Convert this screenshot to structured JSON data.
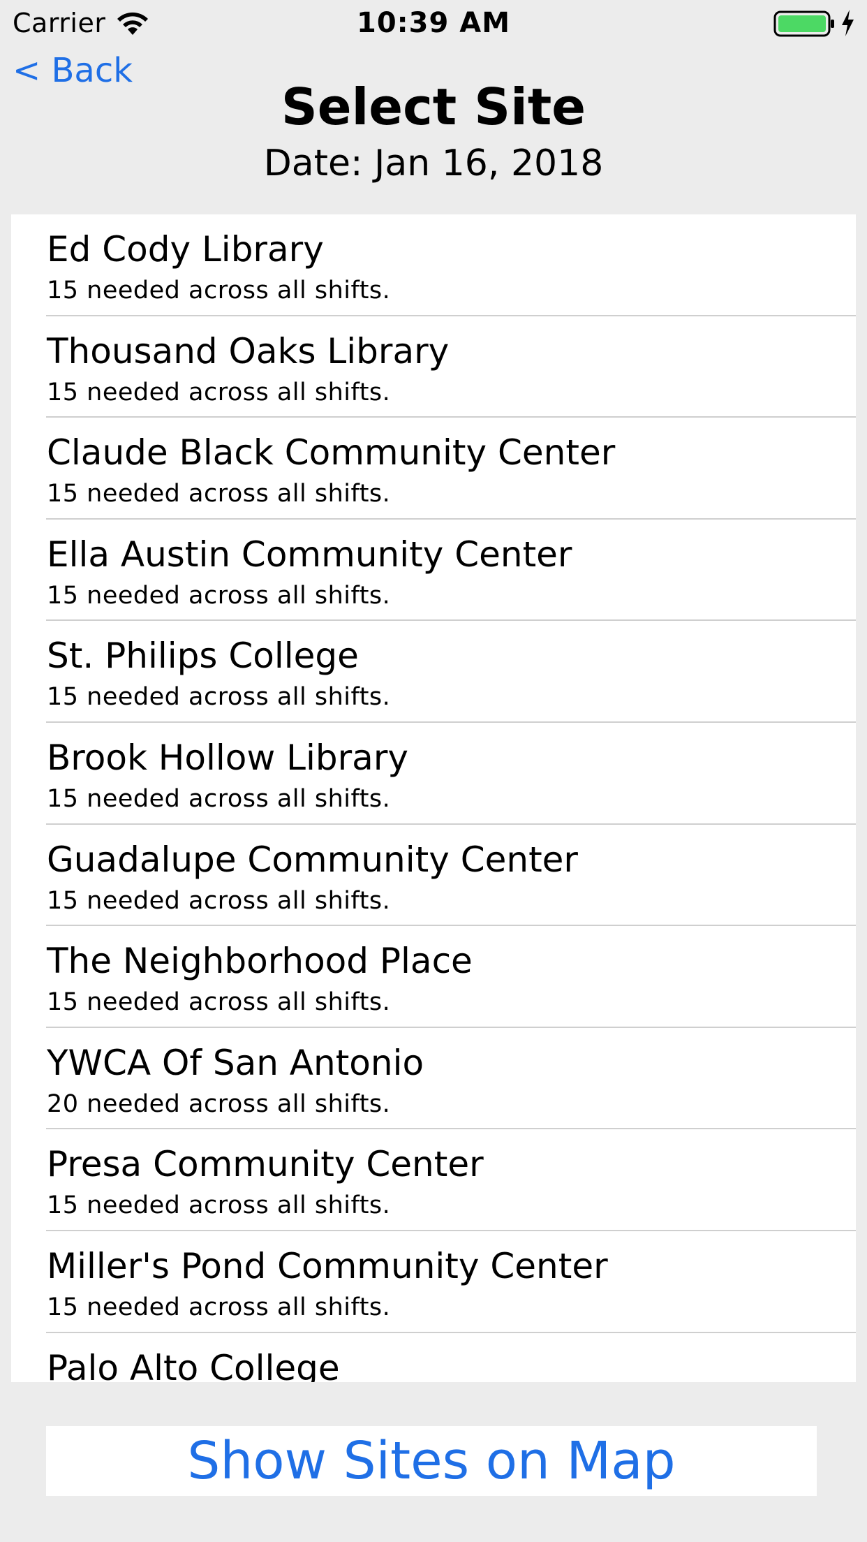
{
  "status_bar": {
    "carrier": "Carrier",
    "time": "10:39 AM",
    "wifi_icon": "wifi-icon",
    "battery_icon": "battery-icon",
    "charging_icon": "bolt-icon",
    "battery_color": "#4cd964"
  },
  "nav": {
    "back_label": "< Back",
    "title": "Select Site",
    "subtitle": "Date: Jan 16, 2018"
  },
  "sites": [
    {
      "name": "Ed Cody Library",
      "detail": "15 needed across all shifts."
    },
    {
      "name": "Thousand Oaks Library",
      "detail": "15 needed across all shifts."
    },
    {
      "name": "Claude Black Community Center",
      "detail": "15 needed across all shifts."
    },
    {
      "name": "Ella Austin Community Center",
      "detail": "15 needed across all shifts."
    },
    {
      "name": "St. Philips College",
      "detail": "15 needed across all shifts."
    },
    {
      "name": "Brook Hollow Library",
      "detail": "15 needed across all shifts."
    },
    {
      "name": "Guadalupe Community Center",
      "detail": "15 needed across all shifts."
    },
    {
      "name": "The Neighborhood Place",
      "detail": "15 needed across all shifts."
    },
    {
      "name": "YWCA Of San Antonio",
      "detail": "20 needed across all shifts."
    },
    {
      "name": "Presa Community Center",
      "detail": "15 needed across all shifts."
    },
    {
      "name": "Miller's Pond Community Center",
      "detail": "15 needed across all shifts."
    },
    {
      "name": "Palo Alto College",
      "detail": ""
    }
  ],
  "footer": {
    "map_button_label": "Show Sites on Map"
  },
  "colors": {
    "accent": "#1f6fe6",
    "background": "#ececec"
  }
}
